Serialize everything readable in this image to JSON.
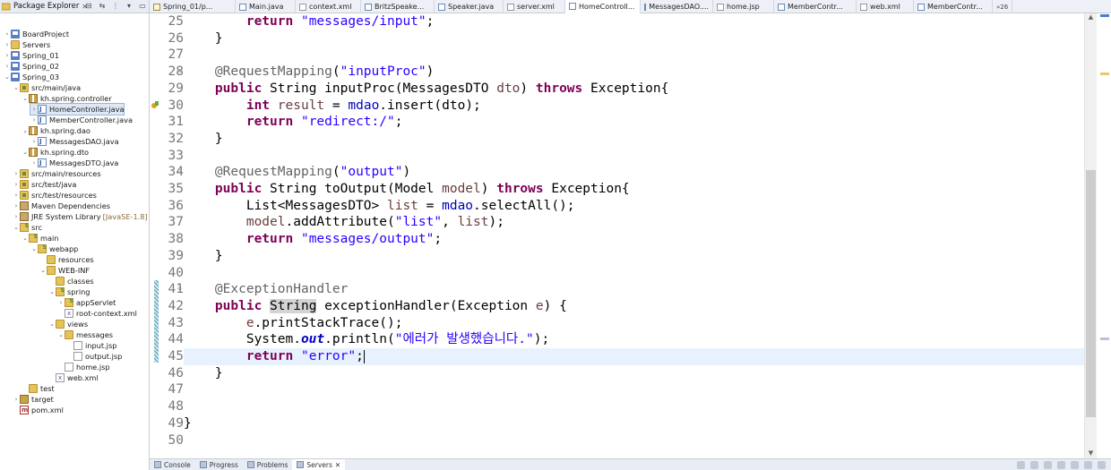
{
  "explorer": {
    "title": "Package Explorer",
    "close": "✕",
    "tree": [
      {
        "label": "BoardProject",
        "icon": "project-icon",
        "twisty": "›",
        "indent": 0
      },
      {
        "label": "Servers",
        "icon": "folder-icon",
        "twisty": "›",
        "indent": 0
      },
      {
        "label": "Spring_01",
        "icon": "project-icon",
        "twisty": "›",
        "indent": 0
      },
      {
        "label": "Spring_02",
        "icon": "project-icon",
        "twisty": "›",
        "indent": 0
      },
      {
        "label": "Spring_03",
        "icon": "project-icon",
        "twisty": "⌄",
        "indent": 0
      },
      {
        "label": "src/main/java",
        "icon": "source-folder-icon",
        "twisty": "⌄",
        "indent": 1
      },
      {
        "label": "kh.spring.controller",
        "icon": "package-icon",
        "twisty": "⌄",
        "indent": 2
      },
      {
        "label": "HomeController.java",
        "icon": "java-file-icon",
        "twisty": "›",
        "indent": 3,
        "selected": true
      },
      {
        "label": "MemberController.java",
        "icon": "java-file-icon",
        "twisty": "›",
        "indent": 3
      },
      {
        "label": "kh.spring.dao",
        "icon": "package-icon",
        "twisty": "⌄",
        "indent": 2
      },
      {
        "label": "MessagesDAO.java",
        "icon": "java-file-icon",
        "twisty": "›",
        "indent": 3
      },
      {
        "label": "kh.spring.dto",
        "icon": "package-icon",
        "twisty": "⌄",
        "indent": 2
      },
      {
        "label": "MessagesDTO.java",
        "icon": "java-file-icon",
        "twisty": "›",
        "indent": 3
      },
      {
        "label": "src/main/resources",
        "icon": "source-folder-icon",
        "twisty": "›",
        "indent": 1
      },
      {
        "label": "src/test/java",
        "icon": "source-folder-icon",
        "twisty": "›",
        "indent": 1
      },
      {
        "label": "src/test/resources",
        "icon": "source-folder-icon",
        "twisty": "›",
        "indent": 1
      },
      {
        "label": "Maven Dependencies",
        "icon": "library-icon",
        "twisty": "›",
        "indent": 1
      },
      {
        "label": "JRE System Library",
        "suffix": "[JavaSE-1.8]",
        "icon": "library-icon",
        "twisty": "›",
        "indent": 1
      },
      {
        "label": "src",
        "icon": "spring-folder-icon",
        "twisty": "⌄",
        "indent": 1
      },
      {
        "label": "main",
        "icon": "spring-folder-icon",
        "twisty": "⌄",
        "indent": 2
      },
      {
        "label": "webapp",
        "icon": "spring-folder-icon",
        "twisty": "⌄",
        "indent": 3
      },
      {
        "label": "resources",
        "icon": "folder-icon",
        "twisty": "",
        "indent": 4
      },
      {
        "label": "WEB-INF",
        "icon": "folder-icon",
        "twisty": "⌄",
        "indent": 4
      },
      {
        "label": "classes",
        "icon": "folder-icon",
        "twisty": "",
        "indent": 5
      },
      {
        "label": "spring",
        "icon": "spring-folder-icon",
        "twisty": "⌄",
        "indent": 5
      },
      {
        "label": "appServlet",
        "icon": "spring-folder-icon",
        "twisty": "›",
        "indent": 6
      },
      {
        "label": "root-context.xml",
        "icon": "xml-file-icon",
        "twisty": "",
        "indent": 6
      },
      {
        "label": "views",
        "icon": "folder-icon",
        "twisty": "⌄",
        "indent": 5
      },
      {
        "label": "messages",
        "icon": "folder-icon",
        "twisty": "⌄",
        "indent": 6
      },
      {
        "label": "input.jsp",
        "icon": "file-icon",
        "twisty": "",
        "indent": 7
      },
      {
        "label": "output.jsp",
        "icon": "file-icon",
        "twisty": "",
        "indent": 7
      },
      {
        "label": "home.jsp",
        "icon": "file-icon",
        "twisty": "",
        "indent": 6
      },
      {
        "label": "web.xml",
        "icon": "xml-file-icon",
        "twisty": "",
        "indent": 5
      },
      {
        "label": "test",
        "icon": "folder-icon",
        "twisty": "",
        "indent": 2
      },
      {
        "label": "target",
        "icon": "target-folder-icon",
        "twisty": "›",
        "indent": 1
      },
      {
        "label": "pom.xml",
        "icon": "pom-file-icon",
        "twisty": "",
        "indent": 1
      }
    ]
  },
  "tabs": [
    {
      "label": "Spring_01/p...",
      "icon": "j"
    },
    {
      "label": "Main.java",
      "icon": "java"
    },
    {
      "label": "context.xml",
      "icon": "x"
    },
    {
      "label": "BritzSpeake...",
      "icon": "java"
    },
    {
      "label": "Speaker.java",
      "icon": "java"
    },
    {
      "label": "server.xml",
      "icon": "x"
    },
    {
      "label": "HomeControll...",
      "icon": "java",
      "active": true
    },
    {
      "label": "MessagesDAO....",
      "icon": "java"
    },
    {
      "label": "home.jsp",
      "icon": "x"
    },
    {
      "label": "MemberContr...",
      "icon": "java"
    },
    {
      "label": "web.xml",
      "icon": "x"
    },
    {
      "label": "MemberContr...",
      "icon": "java"
    }
  ],
  "tabs_overflow": "»26",
  "editor": {
    "lines": [
      {
        "n": "25",
        "html": [
          [
            "",
            "        "
          ],
          [
            "kw",
            "return"
          ],
          [
            "",
            " "
          ],
          [
            "st",
            "\"messages/input\""
          ],
          [
            "",
            ";"
          ]
        ]
      },
      {
        "n": "26",
        "html": [
          [
            "",
            "    }"
          ]
        ]
      },
      {
        "n": "27",
        "html": [
          [
            "",
            ""
          ]
        ]
      },
      {
        "n": "28",
        "fold": true,
        "html": [
          [
            "",
            "    "
          ],
          [
            "an",
            "@RequestMapping"
          ],
          [
            "",
            "("
          ],
          [
            "st",
            "\"inputProc\""
          ],
          [
            "",
            ")"
          ]
        ]
      },
      {
        "n": "29",
        "html": [
          [
            "",
            "    "
          ],
          [
            "kw",
            "public"
          ],
          [
            "",
            " String inputProc(MessagesDTO "
          ],
          [
            "lv",
            "dto"
          ],
          [
            "",
            ") "
          ],
          [
            "kw",
            "throws"
          ],
          [
            "",
            " Exception{"
          ]
        ]
      },
      {
        "n": "30",
        "warn": true,
        "html": [
          [
            "",
            "        "
          ],
          [
            "kw",
            "int"
          ],
          [
            "",
            " "
          ],
          [
            "lv",
            "result"
          ],
          [
            "",
            " = "
          ],
          [
            "fi",
            "mdao"
          ],
          [
            "",
            ".insert(dto);"
          ]
        ]
      },
      {
        "n": "31",
        "html": [
          [
            "",
            "        "
          ],
          [
            "kw",
            "return"
          ],
          [
            "",
            " "
          ],
          [
            "st",
            "\"redirect:/\""
          ],
          [
            "",
            ";"
          ]
        ]
      },
      {
        "n": "32",
        "html": [
          [
            "",
            "    }"
          ]
        ]
      },
      {
        "n": "33",
        "html": [
          [
            "",
            ""
          ]
        ]
      },
      {
        "n": "34",
        "fold": true,
        "html": [
          [
            "",
            "    "
          ],
          [
            "an",
            "@RequestMapping"
          ],
          [
            "",
            "("
          ],
          [
            "st",
            "\"output\""
          ],
          [
            "",
            ")"
          ]
        ]
      },
      {
        "n": "35",
        "html": [
          [
            "",
            "    "
          ],
          [
            "kw",
            "public"
          ],
          [
            "",
            " String toOutput(Model "
          ],
          [
            "lv",
            "model"
          ],
          [
            "",
            ") "
          ],
          [
            "kw",
            "throws"
          ],
          [
            "",
            " Exception{"
          ]
        ]
      },
      {
        "n": "36",
        "html": [
          [
            "",
            "        List<MessagesDTO> "
          ],
          [
            "lv",
            "list"
          ],
          [
            "",
            " = "
          ],
          [
            "fi",
            "mdao"
          ],
          [
            "",
            ".selectAll();"
          ]
        ]
      },
      {
        "n": "37",
        "html": [
          [
            "",
            "        "
          ],
          [
            "lv",
            "model"
          ],
          [
            "",
            ".addAttribute("
          ],
          [
            "st",
            "\"list\""
          ],
          [
            "",
            ", "
          ],
          [
            "lv",
            "list"
          ],
          [
            "",
            ");"
          ]
        ]
      },
      {
        "n": "38",
        "html": [
          [
            "",
            "        "
          ],
          [
            "kw",
            "return"
          ],
          [
            "",
            " "
          ],
          [
            "st",
            "\"messages/output\""
          ],
          [
            "",
            ";"
          ]
        ]
      },
      {
        "n": "39",
        "html": [
          [
            "",
            "    }"
          ]
        ]
      },
      {
        "n": "40",
        "html": [
          [
            "",
            ""
          ]
        ]
      },
      {
        "n": "41",
        "fold": true,
        "html": [
          [
            "",
            "    "
          ],
          [
            "an",
            "@ExceptionHandler"
          ]
        ]
      },
      {
        "n": "42",
        "html": [
          [
            "",
            "    "
          ],
          [
            "kw",
            "public"
          ],
          [
            "",
            " "
          ],
          [
            "hl-occ",
            "String"
          ],
          [
            "",
            " exceptionHandler(Exception "
          ],
          [
            "lv",
            "e"
          ],
          [
            "",
            ") {"
          ]
        ]
      },
      {
        "n": "43",
        "html": [
          [
            "",
            "        "
          ],
          [
            "lv",
            "e"
          ],
          [
            "",
            ".printStackTrace();"
          ]
        ]
      },
      {
        "n": "44",
        "html": [
          [
            "",
            "        System."
          ],
          [
            "sf",
            "out"
          ],
          [
            "",
            ".println("
          ],
          [
            "st",
            "\"에러가 발생했습니다.\""
          ],
          [
            "",
            ");"
          ]
        ]
      },
      {
        "n": "45",
        "current": true,
        "html": [
          [
            "",
            "        "
          ],
          [
            "kw",
            "return"
          ],
          [
            "",
            " "
          ],
          [
            "st",
            "\"error\""
          ],
          [
            "",
            ";"
          ],
          [
            "caret",
            ""
          ]
        ]
      },
      {
        "n": "46",
        "html": [
          [
            "",
            "    }"
          ]
        ]
      },
      {
        "n": "47",
        "html": [
          [
            "",
            ""
          ]
        ]
      },
      {
        "n": "48",
        "html": [
          [
            "",
            ""
          ]
        ]
      },
      {
        "n": "49",
        "html": [
          [
            "",
            "}"
          ]
        ]
      },
      {
        "n": "50",
        "html": [
          [
            "",
            ""
          ]
        ]
      }
    ]
  },
  "bottom_tabs": [
    {
      "label": "Console"
    },
    {
      "label": "Progress"
    },
    {
      "label": "Problems"
    },
    {
      "label": "Servers",
      "active": true,
      "suffix": "✕"
    }
  ],
  "colors": {
    "keyword": "#7f0055",
    "string": "#2a00ff",
    "annotation": "#646464",
    "field": "#0000c0",
    "current_line": "#e8f2fe"
  }
}
